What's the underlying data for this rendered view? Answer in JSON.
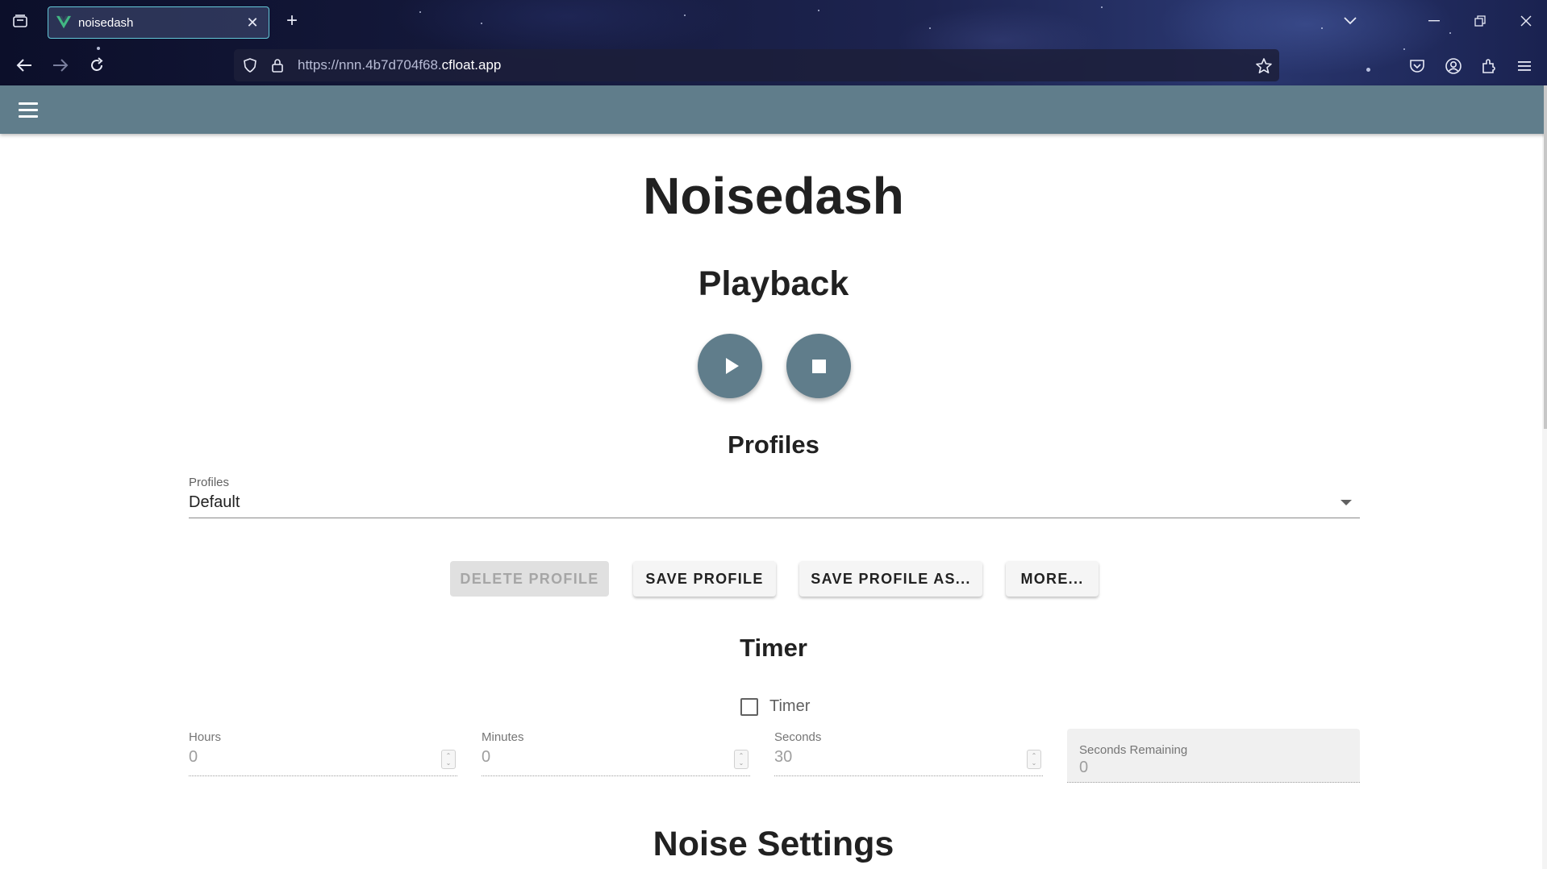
{
  "browser": {
    "tab_title": "noisedash",
    "url_prefix": "https://nnn.4b7d704f68.",
    "url_domain": "cfloat.app",
    "accent": "#63c7d8"
  },
  "app": {
    "bar_color": "#607d8b",
    "title": "Noisedash",
    "playback": {
      "heading": "Playback"
    },
    "profiles": {
      "heading": "Profiles",
      "select_label": "Profiles",
      "selected": "Default",
      "buttons": {
        "delete": "DELETE PROFILE",
        "save": "SAVE PROFILE",
        "save_as": "SAVE PROFILE AS...",
        "more": "MORE..."
      }
    },
    "timer": {
      "heading": "Timer",
      "checkbox_label": "Timer",
      "checked": false,
      "hours_label": "Hours",
      "hours": "0",
      "minutes_label": "Minutes",
      "minutes": "0",
      "seconds_label": "Seconds",
      "seconds": "30",
      "remaining_label": "Seconds Remaining",
      "remaining": "0"
    },
    "noise": {
      "heading": "Noise Settings"
    }
  }
}
